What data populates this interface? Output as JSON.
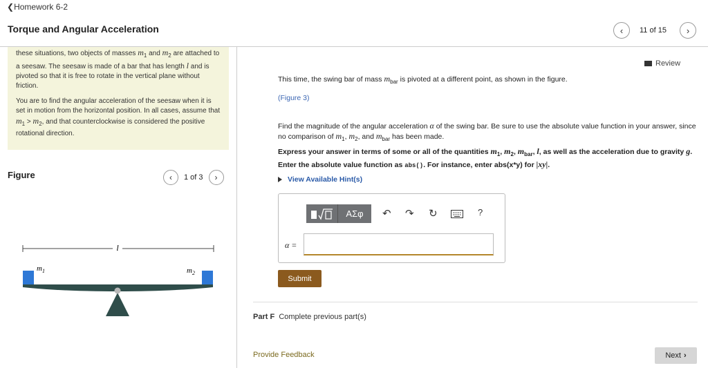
{
  "breadcrumb": "Homework 6-2",
  "page_title": "Torque and Angular Acceleration",
  "nav": {
    "position": "11 of 15",
    "prev_icon": "chevron-left-icon",
    "next_icon": "chevron-right-icon"
  },
  "intro": {
    "p1_a": "these situations, two objects of masses ",
    "m1": "m",
    "m1_sub": "1",
    "p1_b": " and ",
    "m2": "m",
    "m2_sub": "2",
    "p1_c": " are attached to a seesaw. The seesaw is made of a bar that has length ",
    "l": "l",
    "p1_d": " and is pivoted so that it is free to rotate in the vertical plane without friction.",
    "p2_a": "You are to find the angular acceleration of the seesaw when it is set in motion from the horizontal position. In all cases, assume that ",
    "p2_gt": " > ",
    "p2_b": ", and that counterclockwise is considered the positive rotational direction."
  },
  "figure": {
    "label": "Figure",
    "pager": "1 of 3",
    "length_label": "l",
    "m1_label": "m",
    "m1_sub": "1",
    "m2_label": "m",
    "m2_sub": "2",
    "colors": {
      "bar": "#2f4d4a",
      "mass": "#2e78d6",
      "pivot_dot": "#b8b8b8"
    }
  },
  "review": "Review",
  "main": {
    "line1_a": "This time, the swing bar of mass ",
    "mbar": "m",
    "mbar_sub": "bar",
    "line1_b": " is pivoted at a different point, as shown in the figure.",
    "fig_link": "(Figure 3)",
    "q_a": "Find the magnitude of the angular acceleration ",
    "alpha": "α",
    "q_b": " of the swing bar. Be sure to use the absolute value function in your answer, since no comparison of ",
    "q_c": ", ",
    "q_d": ", and ",
    "q_e": " has been made.",
    "instr_a": "Express your answer in terms of some or all of the quantities ",
    "instr_b": ", as well as the acceleration due to gravity ",
    "g": "g",
    "instr_c": ". Enter the absolute value function as ",
    "abs_code": "abs()",
    "instr_d": ". For instance, enter abs(x*y) for ",
    "xy": "|xy|",
    "instr_e": ".",
    "sep": ", "
  },
  "hint_label": "View Available Hint(s)",
  "toolbar": {
    "templates_icon": "templates-icon",
    "symbols_label": "ΑΣφ",
    "undo_icon": "undo-icon",
    "redo_icon": "redo-icon",
    "reset_icon": "reset-icon",
    "keyboard_icon": "keyboard-icon",
    "help_label": "?"
  },
  "answer": {
    "var_label": "α =",
    "value": ""
  },
  "submit_label": "Submit",
  "part_f": {
    "part": "Part F",
    "status": "Complete previous part(s)"
  },
  "feedback_label": "Provide Feedback",
  "next_label": "Next"
}
